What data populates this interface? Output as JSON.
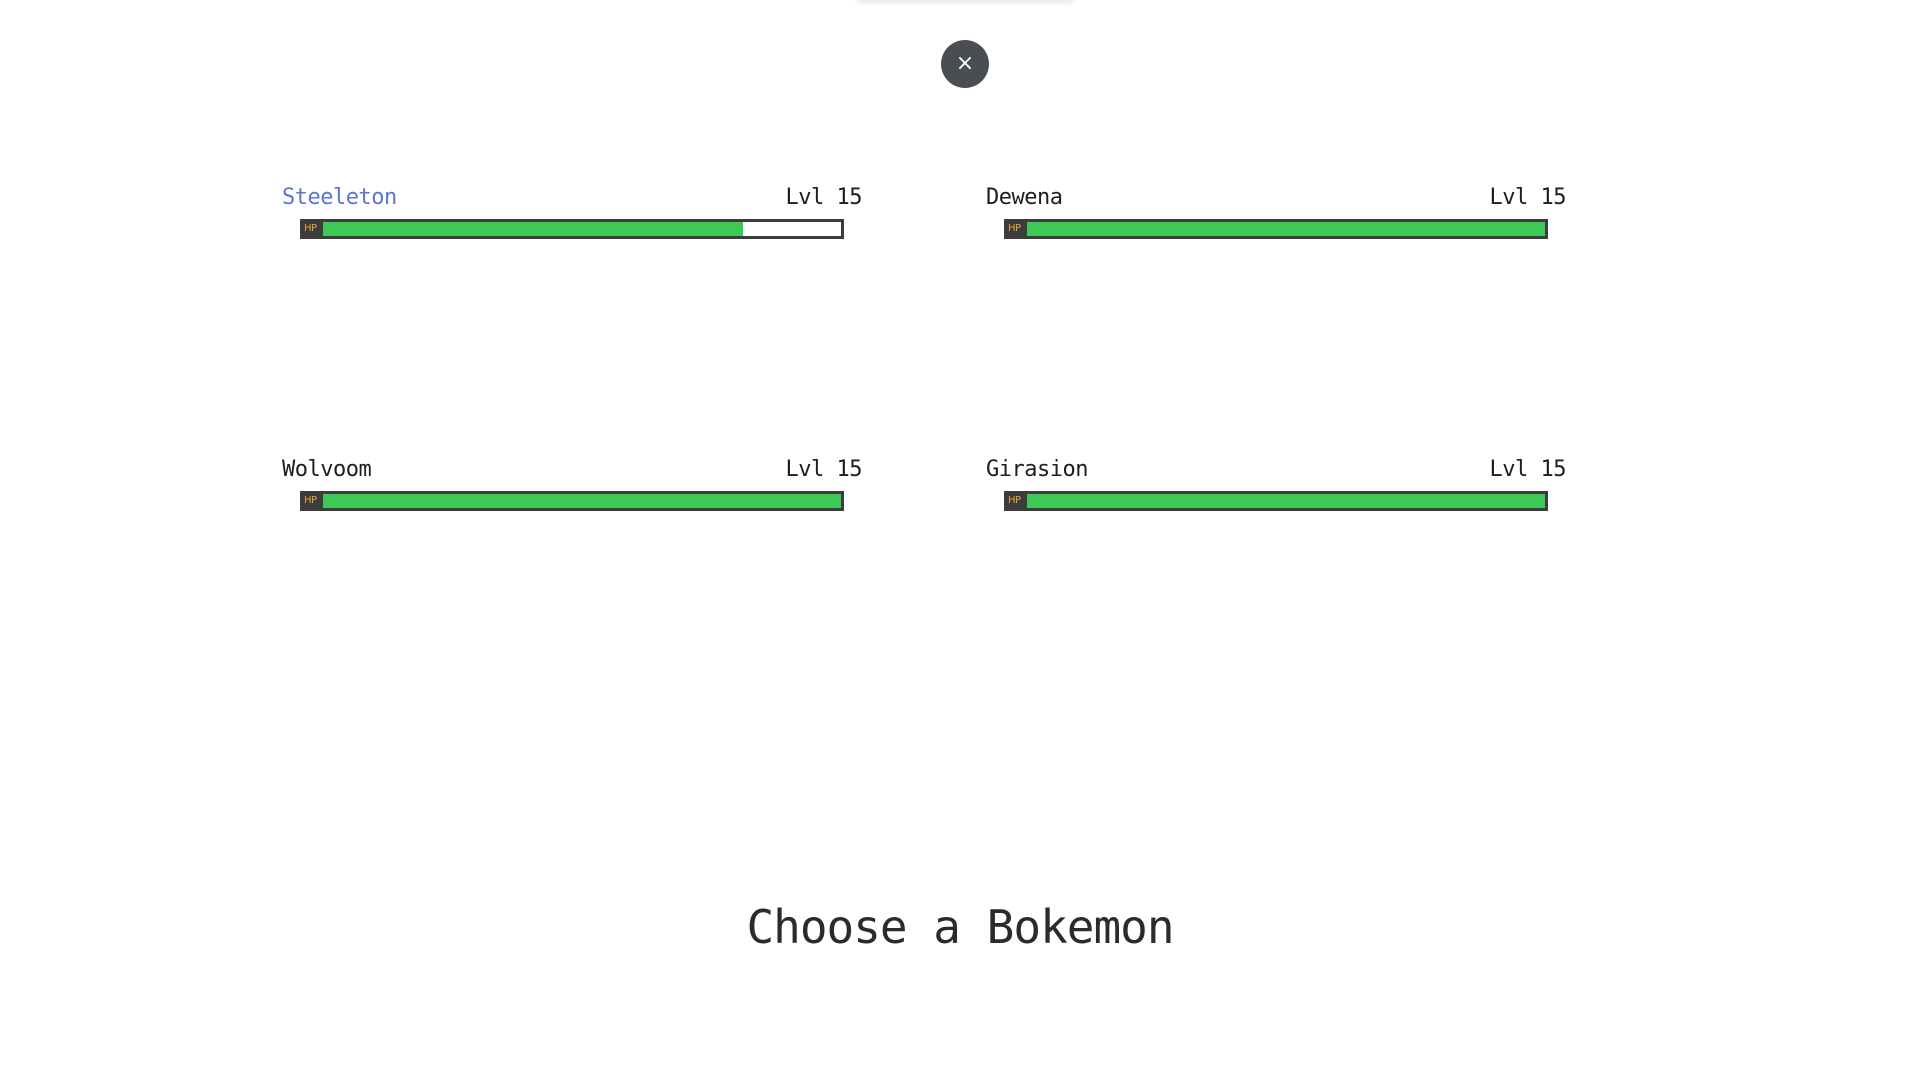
{
  "close_button": {
    "icon": "close-icon",
    "glyph": "×"
  },
  "party": [
    {
      "name": "Steeleton",
      "level": "Lvl 15",
      "hp_label": "HP",
      "hp_fraction": 0.81,
      "selected": true
    },
    {
      "name": "Dewena",
      "level": "Lvl 15",
      "hp_label": "HP",
      "hp_fraction": 1.0,
      "selected": false
    },
    {
      "name": "Wolvoom",
      "level": "Lvl 15",
      "hp_label": "HP",
      "hp_fraction": 1.0,
      "selected": false
    },
    {
      "name": "Girasion",
      "level": "Lvl 15",
      "hp_label": "HP",
      "hp_fraction": 1.0,
      "selected": false
    }
  ],
  "prompt": "Choose a Bokemon",
  "colors": {
    "hp_fill": "#3ec856",
    "hp_frame": "#3c3c3c",
    "selected_name": "#5b75d6",
    "hp_label": "#e8a63a"
  }
}
